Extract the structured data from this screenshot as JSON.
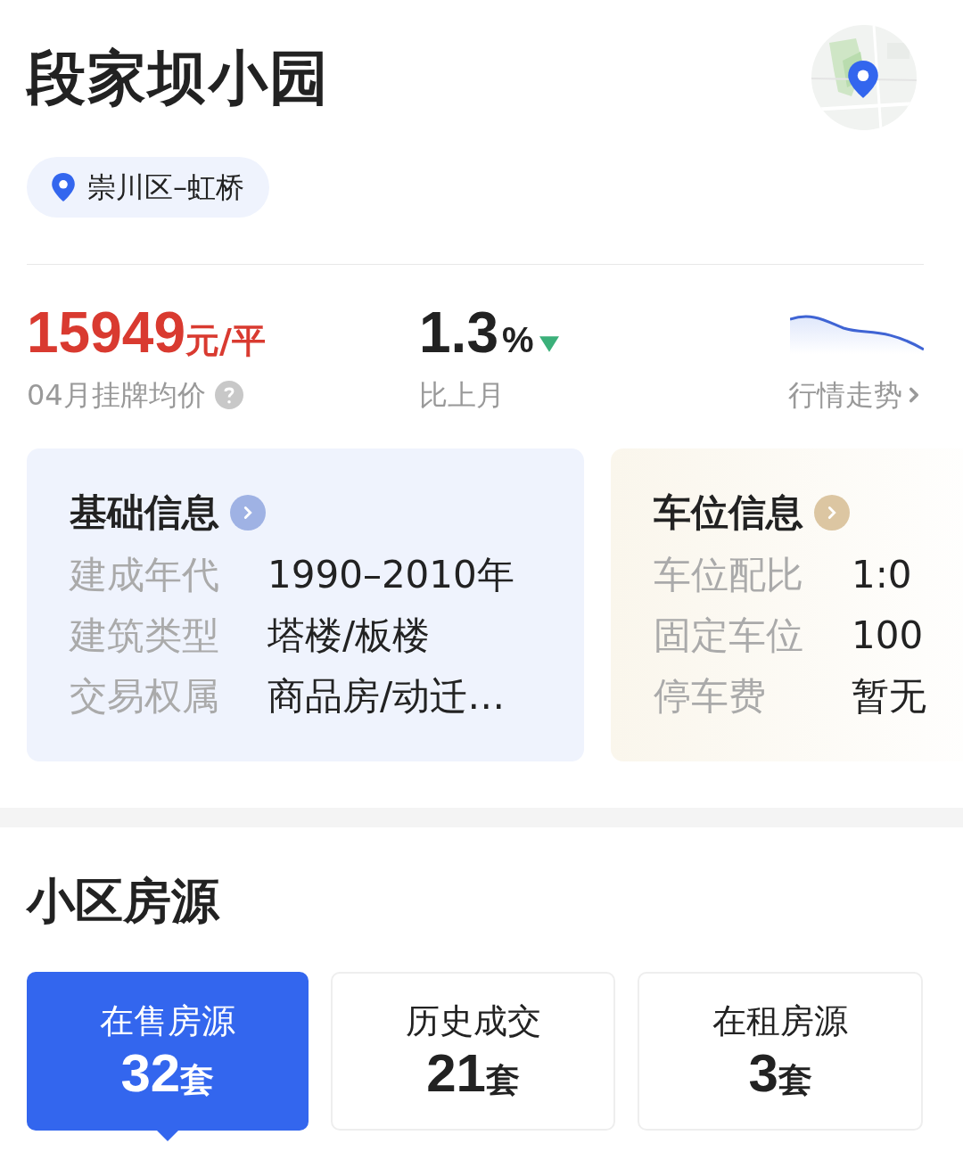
{
  "title": "段家坝小园",
  "location": "崇川区–虹桥",
  "price": {
    "value": "15949",
    "unit": "元/平",
    "label": "04月挂牌均价"
  },
  "change": {
    "value": "1.3",
    "unit": "%",
    "decreased": true,
    "label": "比上月"
  },
  "market_trend": {
    "label": "行情走势"
  },
  "info_cards": [
    {
      "title": "基础信息",
      "color": "#9fb2e4",
      "rows": [
        {
          "label": "建成年代",
          "value": "1990–2010年"
        },
        {
          "label": "建筑类型",
          "value": "塔楼/板楼"
        },
        {
          "label": "交易权属",
          "value": "商品房/动迁…"
        }
      ]
    },
    {
      "title": "车位信息",
      "color": "#dcc6a2",
      "rows": [
        {
          "label": "车位配比",
          "value": "1:0"
        },
        {
          "label": "固定车位",
          "value": "100"
        },
        {
          "label": "停车费",
          "value": "暂无"
        }
      ]
    }
  ],
  "listings": {
    "title": "小区房源",
    "tabs": [
      {
        "label": "在售房源",
        "count": "32",
        "unit": "套",
        "selected": true
      },
      {
        "label": "历史成交",
        "count": "21",
        "unit": "套",
        "selected": false
      },
      {
        "label": "在租房源",
        "count": "3",
        "unit": "套",
        "selected": false
      }
    ]
  }
}
